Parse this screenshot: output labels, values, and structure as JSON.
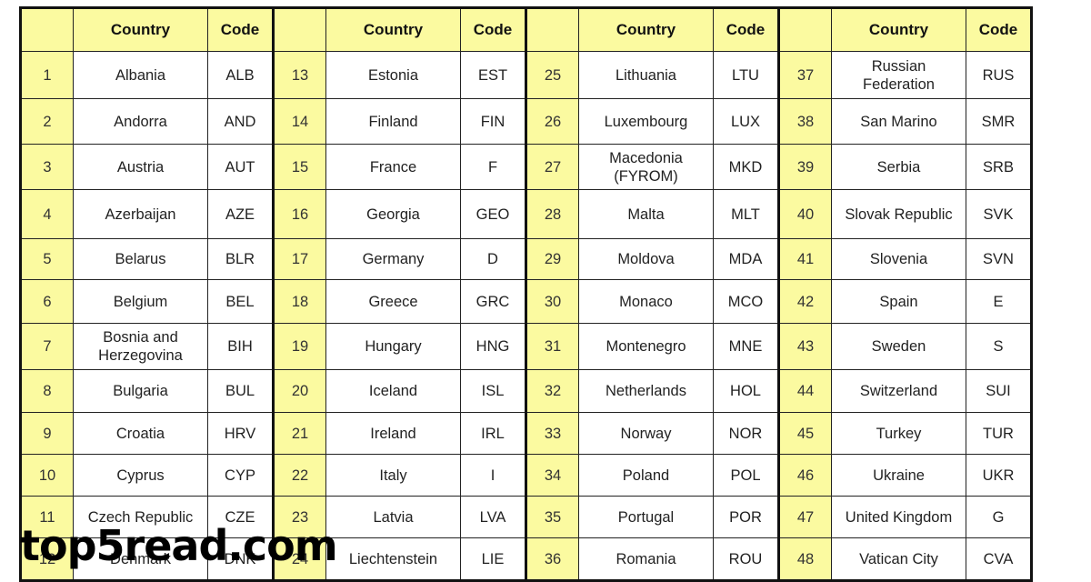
{
  "table": {
    "headers": {
      "number": "",
      "country": "Country",
      "code": "Code"
    },
    "groups": [
      {
        "rows": [
          {
            "num": "1",
            "country": "Albania",
            "code": "ALB"
          },
          {
            "num": "2",
            "country": "Andorra",
            "code": "AND"
          },
          {
            "num": "3",
            "country": "Austria",
            "code": "AUT"
          },
          {
            "num": "4",
            "country": "Azerbaijan",
            "code": "AZE"
          },
          {
            "num": "5",
            "country": "Belarus",
            "code": "BLR"
          },
          {
            "num": "6",
            "country": "Belgium",
            "code": "BEL"
          },
          {
            "num": "7",
            "country": "Bosnia and Herzegovina",
            "code": "BIH"
          },
          {
            "num": "8",
            "country": "Bulgaria",
            "code": "BUL"
          },
          {
            "num": "9",
            "country": "Croatia",
            "code": "HRV"
          },
          {
            "num": "10",
            "country": "Cyprus",
            "code": "CYP"
          },
          {
            "num": "11",
            "country": "Czech Republic",
            "code": "CZE"
          },
          {
            "num": "12",
            "country": "Denmark",
            "code": "DNK"
          }
        ]
      },
      {
        "rows": [
          {
            "num": "13",
            "country": "Estonia",
            "code": "EST"
          },
          {
            "num": "14",
            "country": "Finland",
            "code": "FIN"
          },
          {
            "num": "15",
            "country": "France",
            "code": "F"
          },
          {
            "num": "16",
            "country": "Georgia",
            "code": "GEO"
          },
          {
            "num": "17",
            "country": "Germany",
            "code": "D"
          },
          {
            "num": "18",
            "country": "Greece",
            "code": "GRC"
          },
          {
            "num": "19",
            "country": "Hungary",
            "code": "HNG"
          },
          {
            "num": "20",
            "country": "Iceland",
            "code": "ISL"
          },
          {
            "num": "21",
            "country": "Ireland",
            "code": "IRL"
          },
          {
            "num": "22",
            "country": "Italy",
            "code": "I"
          },
          {
            "num": "23",
            "country": "Latvia",
            "code": "LVA"
          },
          {
            "num": "24",
            "country": "Liechtenstein",
            "code": "LIE"
          }
        ]
      },
      {
        "rows": [
          {
            "num": "25",
            "country": "Lithuania",
            "code": "LTU"
          },
          {
            "num": "26",
            "country": "Luxembourg",
            "code": "LUX"
          },
          {
            "num": "27",
            "country": "Macedonia (FYROM)",
            "code": "MKD"
          },
          {
            "num": "28",
            "country": "Malta",
            "code": "MLT"
          },
          {
            "num": "29",
            "country": "Moldova",
            "code": "MDA"
          },
          {
            "num": "30",
            "country": "Monaco",
            "code": "MCO"
          },
          {
            "num": "31",
            "country": "Montenegro",
            "code": "MNE"
          },
          {
            "num": "32",
            "country": "Netherlands",
            "code": "HOL"
          },
          {
            "num": "33",
            "country": "Norway",
            "code": "NOR"
          },
          {
            "num": "34",
            "country": "Poland",
            "code": "POL"
          },
          {
            "num": "35",
            "country": "Portugal",
            "code": "POR"
          },
          {
            "num": "36",
            "country": "Romania",
            "code": "ROU"
          }
        ]
      },
      {
        "rows": [
          {
            "num": "37",
            "country": "Russian Federation",
            "code": "RUS"
          },
          {
            "num": "38",
            "country": "San Marino",
            "code": "SMR"
          },
          {
            "num": "39",
            "country": "Serbia",
            "code": "SRB"
          },
          {
            "num": "40",
            "country": "Slovak Republic",
            "code": "SVK"
          },
          {
            "num": "41",
            "country": "Slovenia",
            "code": "SVN"
          },
          {
            "num": "42",
            "country": "Spain",
            "code": "E"
          },
          {
            "num": "43",
            "country": "Sweden",
            "code": "S"
          },
          {
            "num": "44",
            "country": "Switzerland",
            "code": "SUI"
          },
          {
            "num": "45",
            "country": "Turkey",
            "code": "TUR"
          },
          {
            "num": "46",
            "country": "Ukraine",
            "code": "UKR"
          },
          {
            "num": "47",
            "country": "United Kingdom",
            "code": "G"
          },
          {
            "num": "48",
            "country": "Vatican City",
            "code": "CVA"
          }
        ]
      }
    ]
  },
  "watermark": "top5read.com",
  "colors": {
    "header_bg": "#fbfaa0",
    "number_bg": "#fbfaa0",
    "border": "#111111"
  }
}
